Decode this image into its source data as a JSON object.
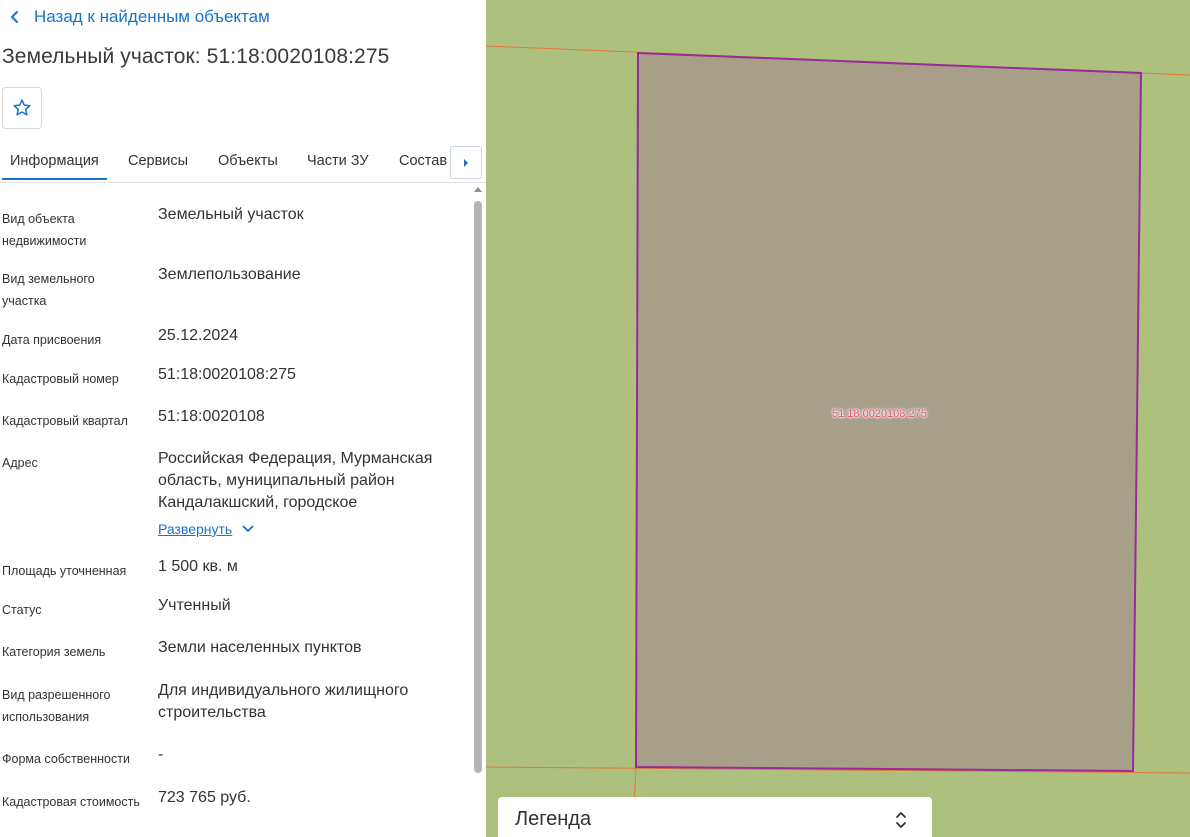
{
  "panel": {
    "back_label": "Назад к найденным объектам",
    "title": "Земельный участок: 51:18:0020108:275",
    "favorite_icon": "star-outline-icon",
    "tabs": [
      "Информация",
      "Сервисы",
      "Объекты",
      "Части ЗУ",
      "Состав"
    ],
    "active_tab": "Информация",
    "tabs_scroll_icon": "caret-right-icon",
    "fields": [
      {
        "label": "Вид объекта недвижимости",
        "value": "Земельный участок"
      },
      {
        "label": "Вид земельного участка",
        "value": "Землепользование"
      },
      {
        "label": "Дата присвоения",
        "value": "25.12.2024"
      },
      {
        "label": "Кадастровый номер",
        "value": "51:18:0020108:275"
      },
      {
        "label": "Кадастровый квартал",
        "value": "51:18:0020108"
      },
      {
        "label": "Адрес",
        "value": "Российская Федерация, Мурманская область, муниципальный район Кандалакшский, городское"
      },
      {
        "label": "Площадь уточненная",
        "value": "1 500 кв. м"
      },
      {
        "label": "Статус",
        "value": "Учтенный"
      },
      {
        "label": "Категория земель",
        "value": "Земли населенных пунктов"
      },
      {
        "label": "Вид разрешенного использования",
        "value": "Для индивидуального жилищного строительства"
      },
      {
        "label": "Форма собственности",
        "value": "-"
      },
      {
        "label": "Кадастровая стоимость",
        "value": "723 765 руб."
      }
    ],
    "expand_label": "Развернуть"
  },
  "map": {
    "parcel_label": "51:18:0020108:275",
    "legend_label": "Легенда",
    "colors": {
      "background": "#aec07e",
      "parcel_fill": "#a89f88",
      "parcel_border": "#9a2a9a",
      "boundary_line": "#e07a3a",
      "accent": "#1a73c8"
    }
  }
}
